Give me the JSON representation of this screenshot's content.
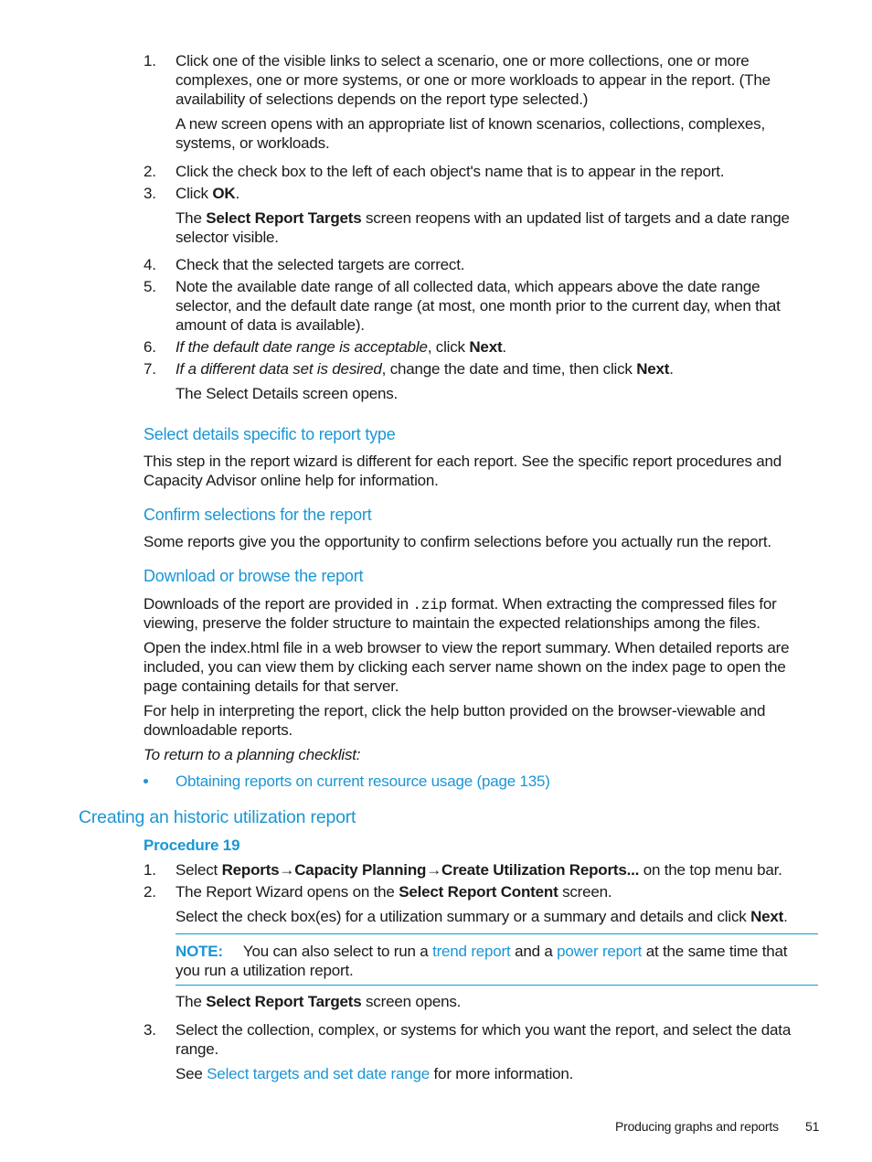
{
  "steps_a": [
    {
      "num": "1.",
      "lines": [
        "Click one of the visible links to select a scenario, one or more collections, one or more",
        "complexes, one or more systems, or one or more workloads to appear in the report. (The",
        "availability of selections depends on the report type selected.)"
      ]
    },
    {
      "sub": [
        "A new screen opens with an appropriate list of known scenarios, collections, complexes,",
        "systems, or workloads."
      ]
    },
    {
      "num": "2.",
      "text": "Click the check box to the left of each object's name that is to appear in the report."
    },
    {
      "num": "3.",
      "pre": "Click ",
      "bold": "OK",
      "post": "."
    },
    {
      "sub_rich": {
        "pre": "The ",
        "bold": "Select Report Targets",
        "post": " screen reopens with an updated list of targets and a date range",
        "line2": "selector visible."
      }
    },
    {
      "num": "4.",
      "text": "Check that the selected targets are correct."
    },
    {
      "num": "5.",
      "lines": [
        "Note the available date range of all collected data, which appears above the date range",
        "selector, and the default date range (at most, one month prior to the current day, when that",
        "amount of data is available)."
      ]
    },
    {
      "num": "6.",
      "italic": "If the default date range is acceptable",
      "mid": ", click ",
      "bold": "Next",
      "post": "."
    },
    {
      "num": "7.",
      "italic": "If a different data set is desired",
      "mid": ", change the date and time, then click ",
      "bold": "Next",
      "post": "."
    },
    {
      "sub": [
        "The Select Details screen opens."
      ]
    }
  ],
  "section_select_details": {
    "heading": "Select details specific to report type",
    "body": [
      "This step in the report wizard is different for each report. See the specific report procedures and",
      "Capacity Advisor online help for information."
    ]
  },
  "section_confirm": {
    "heading": "Confirm selections for the report",
    "body": "Some reports give you the opportunity to confirm selections before you actually run the report."
  },
  "section_download": {
    "heading": "Download or browse the report",
    "p1_pre": "Downloads of the report are provided in ",
    "p1_code": ".zip",
    "p1_post": " format. When extracting the compressed files for",
    "p1_line2": "viewing, preserve the folder structure to maintain the expected relationships among the files.",
    "p2": [
      "Open the index.html file in a web browser to view the report summary. When detailed reports are",
      "included, you can view them by clicking each server name shown on the index page to open the",
      "page containing details for that server."
    ],
    "p3": [
      "For help in interpreting the report, click the help button provided on the browser-viewable and",
      "downloadable reports."
    ],
    "p4_italic": "To return to a planning checklist:",
    "checklist_link": "Obtaining reports on current resource usage (page 135)"
  },
  "section_historic": {
    "heading": "Creating an historic utilization report",
    "procedure": "Procedure 19",
    "step1": {
      "num": "1.",
      "pre": "Select ",
      "b1": "Reports",
      "arrow": "→",
      "b2": "Capacity Planning",
      "b3": "Create Utilization Reports...",
      "post": " on the top menu bar."
    },
    "step2": {
      "num": "2.",
      "pre": "The Report Wizard opens on the ",
      "bold": "Select Report Content",
      "post": " screen."
    },
    "step2_sub": {
      "pre": "Select the check box(es) for a utilization summary or a summary and details and click ",
      "bold": "Next",
      "post": "."
    },
    "note": {
      "label": "NOTE:",
      "pre": "You can also select to run a ",
      "link1": "trend report",
      "mid": " and a ",
      "link2": "power report",
      "post": " at the same time that",
      "line2": "you run a utilization report."
    },
    "step2_after": {
      "pre": "The ",
      "bold": "Select Report Targets",
      "post": " screen opens."
    },
    "step3": {
      "num": "3.",
      "lines": [
        "Select the collection, complex, or systems for which you want the report, and select the data",
        "range."
      ]
    },
    "step3_sub": {
      "pre": "See ",
      "link": "Select targets and set date range",
      "post": " for more information."
    }
  },
  "footer": {
    "title": "Producing graphs and reports",
    "page": "51"
  }
}
